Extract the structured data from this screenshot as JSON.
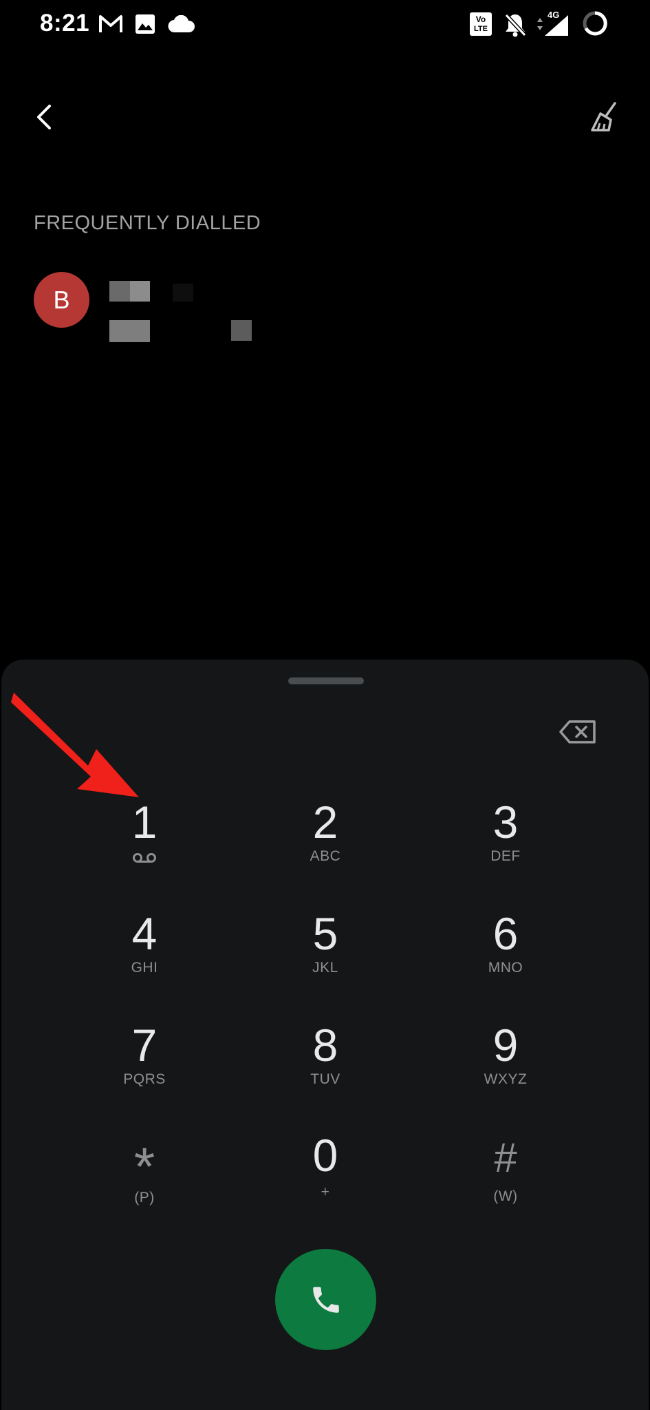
{
  "status_bar": {
    "time": "8:21",
    "icons": [
      "gmail-icon",
      "gallery-icon",
      "cloud-icon",
      "volte-icon",
      "mute-bell-icon",
      "4g-signal-icon",
      "battery-ring-icon"
    ],
    "network_label": "4G",
    "volte_top": "Vo",
    "volte_bottom": "LTE"
  },
  "toolbar": {
    "back_icon": "chevron-left-icon",
    "clear_icon": "broom-icon"
  },
  "frequently_dialled": {
    "title": "FREQUENTLY DIALLED",
    "contacts": [
      {
        "initial": "B",
        "avatar_color": "#b53834"
      }
    ]
  },
  "dialpad": {
    "backspace_icon": "backspace-icon",
    "keys": [
      {
        "digit": "1",
        "letters": ""
      },
      {
        "digit": "2",
        "letters": "ABC"
      },
      {
        "digit": "3",
        "letters": "DEF"
      },
      {
        "digit": "4",
        "letters": "GHI"
      },
      {
        "digit": "5",
        "letters": "JKL"
      },
      {
        "digit": "6",
        "letters": "MNO"
      },
      {
        "digit": "7",
        "letters": "PQRS"
      },
      {
        "digit": "8",
        "letters": "TUV"
      },
      {
        "digit": "9",
        "letters": "WXYZ"
      },
      {
        "digit": "*",
        "letters": "(P)"
      },
      {
        "digit": "0",
        "letters": "+"
      },
      {
        "digit": "#",
        "letters": "(W)"
      }
    ],
    "call_icon": "phone-icon",
    "call_color": "#0d7a3f"
  },
  "annotation": {
    "arrow_color": "#f0201a",
    "target": "key-1"
  }
}
